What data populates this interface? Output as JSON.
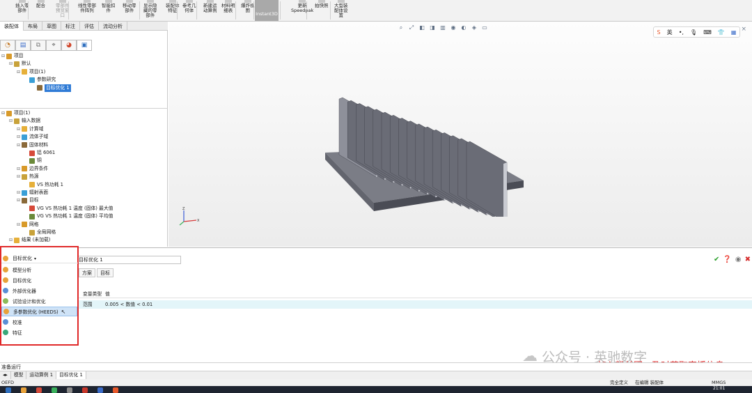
{
  "ribbon": {
    "items": [
      {
        "label": "插入零\n部件",
        "dim": false
      },
      {
        "label": "配合",
        "dim": false
      },
      {
        "label": "零部件\n预览窗\n口",
        "dim": true
      },
      {
        "label": "线性零部\n件阵列",
        "dim": false
      },
      {
        "label": "智能扣\n件",
        "dim": false
      },
      {
        "label": "移动零\n部件",
        "dim": false
      },
      {
        "label": "显示隐\n藏的零\n部件",
        "dim": false
      },
      {
        "label": "装配体\n特征",
        "dim": false
      },
      {
        "label": "参考几\n何体",
        "dim": false
      },
      {
        "label": "新建运\n动算例",
        "dim": false
      },
      {
        "label": "材料明\n细表",
        "dim": false
      },
      {
        "label": "爆炸视\n图",
        "dim": false
      },
      {
        "label": "更新\nSpeedpak",
        "dim": false
      },
      {
        "label": "拍快照",
        "dim": false
      },
      {
        "label": "大型装\n配体设\n置",
        "dim": false
      }
    ],
    "instant3d": "Instant3D"
  },
  "left_panel": {
    "tabs": [
      "装配体",
      "布局",
      "草图",
      "标注",
      "评估",
      "流动分析"
    ],
    "pm_icons": [
      "feature-tree-icon",
      "property-manager-icon",
      "config-manager-icon",
      "dimxpert-icon",
      "display-manager-icon",
      "flow-tab-icon"
    ],
    "top_tree": [
      {
        "label": "项目",
        "indent": 0
      },
      {
        "label": "默认",
        "indent": 1
      },
      {
        "label": "项目(1)",
        "indent": 2
      },
      {
        "label": "参数研究",
        "indent": 3
      },
      {
        "label": "目标优化 1",
        "indent": 4,
        "selected": true
      }
    ],
    "bottom_tree": [
      {
        "label": "项目(1)",
        "indent": 0
      },
      {
        "label": "输入数据",
        "indent": 1
      },
      {
        "label": "计算域",
        "indent": 2
      },
      {
        "label": "流体子域",
        "indent": 2
      },
      {
        "label": "固体材料",
        "indent": 2
      },
      {
        "label": "铝 6061",
        "indent": 3
      },
      {
        "label": "铜",
        "indent": 3
      },
      {
        "label": "边界条件",
        "indent": 2
      },
      {
        "label": "热源",
        "indent": 2
      },
      {
        "label": "VS 热功耗 1",
        "indent": 3
      },
      {
        "label": "辐射表面",
        "indent": 2
      },
      {
        "label": "目标",
        "indent": 2
      },
      {
        "label": "VG VS 热功耗 1 温度 (固体) 最大值",
        "indent": 3
      },
      {
        "label": "VG VS 热功耗 1 温度 (固体) 平均值",
        "indent": 3
      },
      {
        "label": "网格",
        "indent": 2
      },
      {
        "label": "全局网格",
        "indent": 3
      },
      {
        "label": "结果 (未加载)",
        "indent": 1
      }
    ]
  },
  "graphics": {
    "view_icons": [
      "search-icon",
      "zoom-fit-icon",
      "section-icon",
      "view-orientation-icon",
      "display-style-icon",
      "hide-show-icon",
      "appearance-icon",
      "scene-icon",
      "monitor-icon"
    ],
    "ime_bar": [
      "S",
      "英",
      "•,",
      "mic",
      "kb",
      "shirt",
      "grid"
    ],
    "close_icon": "×"
  },
  "bottom": {
    "dropdown_label": "目标优化",
    "name_value": "目标优化 1",
    "subtabs": [
      "方案",
      "目标"
    ],
    "table_headers": [
      "变量类型",
      "值"
    ],
    "table_rows": [
      {
        "type": "范围",
        "value": "0.005 < 数值 < 0.01"
      }
    ],
    "menu_items": [
      {
        "label": "模型分析",
        "hover": false,
        "color": "#e8a23a"
      },
      {
        "label": "目标优化",
        "hover": false,
        "color": "#e8a23a"
      },
      {
        "label": "外部优化器",
        "hover": false,
        "color": "#5a8fd6"
      },
      {
        "label": "试验设计和优化",
        "hover": false,
        "color": "#8dbb5a"
      },
      {
        "label": "多参数优化 (HEEDS)",
        "hover": true,
        "color": "#e8a23a"
      },
      {
        "label": "校准",
        "hover": false,
        "color": "#5a8fd6"
      },
      {
        "label": "特征",
        "hover": false,
        "color": "#3aa87a"
      }
    ]
  },
  "exec_bar": "准备运行",
  "model_tabs": [
    "模型",
    "运动算例 1",
    "目标优化 1"
  ],
  "status": {
    "left": "OEFD",
    "right": [
      "完全定义",
      "在编辑 装配体",
      "MMGS"
    ],
    "time": "21:01"
  },
  "watermark": "公众号 · 英驰数字",
  "overlay_text": "加入粉丝团，及时获取直播信息",
  "colors": {
    "accent_red": "#e02828",
    "selection_blue": "#2f7bd6",
    "table_row_bg": "#e3f5f9",
    "heatsink_gray": "#5d5f68"
  }
}
